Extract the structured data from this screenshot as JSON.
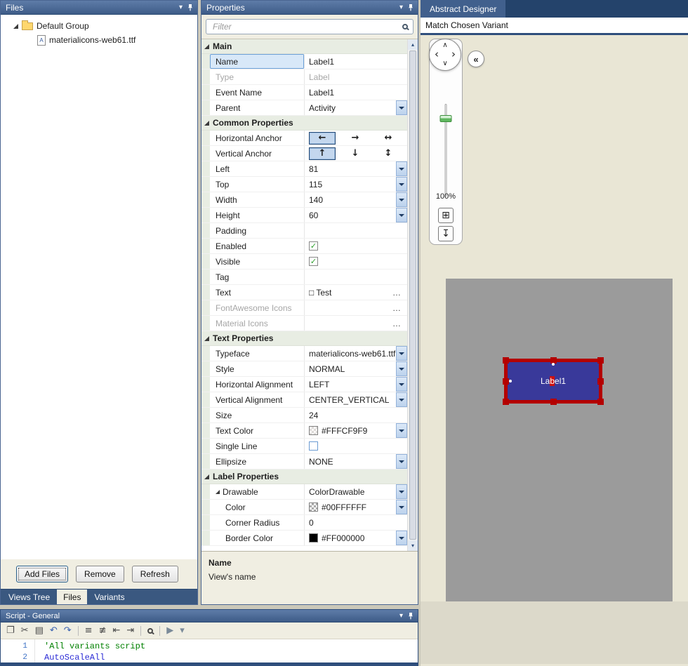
{
  "ui": {
    "menu_glyph": "▾",
    "check_glyph": "✓",
    "ellipsis_glyph": "…",
    "scroll_up_glyph": "▴",
    "scroll_down_glyph": "▾"
  },
  "files": {
    "title": "Files",
    "group_label": "Default Group",
    "file_label": "materialicons-web61.ttf",
    "file_icon_letter": "A",
    "buttons": {
      "add": "Add Files",
      "remove": "Remove",
      "refresh": "Refresh"
    },
    "tabs": {
      "views_tree": "Views Tree",
      "files": "Files",
      "variants": "Variants"
    }
  },
  "properties": {
    "title": "Properties",
    "filter_placeholder": "Filter",
    "description_title": "Name",
    "description_text": "View's name",
    "sections": [
      {
        "title": "Main",
        "rows": [
          {
            "label": "Name",
            "value": "Label1",
            "kind": "text",
            "selected": true
          },
          {
            "label": "Type",
            "value": "Label",
            "kind": "text",
            "muted": true
          },
          {
            "label": "Event Name",
            "value": "Label1",
            "kind": "text"
          },
          {
            "label": "Parent",
            "value": "Activity",
            "kind": "dropdown"
          }
        ]
      },
      {
        "title": "Common Properties",
        "rows": [
          {
            "label": "Horizontal Anchor",
            "kind": "anchors",
            "options": [
              "←",
              "→",
              "↔"
            ],
            "selected_index": 0
          },
          {
            "label": "Vertical Anchor",
            "kind": "anchors",
            "options": [
              "↑",
              "↓",
              "↕"
            ],
            "selected_index": 0
          },
          {
            "label": "Left",
            "value": "81",
            "kind": "dropdown"
          },
          {
            "label": "Top",
            "value": "115",
            "kind": "dropdown"
          },
          {
            "label": "Width",
            "value": "140",
            "kind": "dropdown"
          },
          {
            "label": "Height",
            "value": "60",
            "kind": "dropdown"
          },
          {
            "label": "Padding",
            "kind": "empty"
          },
          {
            "label": "Enabled",
            "kind": "checkbox",
            "checked": true
          },
          {
            "label": "Visible",
            "kind": "checkbox",
            "checked": true
          },
          {
            "label": "Tag",
            "kind": "empty"
          },
          {
            "label": "Text",
            "value": "□ Test",
            "kind": "ellipsis"
          },
          {
            "label": "FontAwesome Icons",
            "kind": "ellipsis",
            "muted": true
          },
          {
            "label": "Material Icons",
            "kind": "ellipsis",
            "muted": true
          }
        ]
      },
      {
        "title": "Text Properties",
        "rows": [
          {
            "label": "Typeface",
            "value": "materialicons-web61.ttf",
            "kind": "dropdown"
          },
          {
            "label": "Style",
            "value": "NORMAL",
            "kind": "dropdown"
          },
          {
            "label": "Horizontal Alignment",
            "value": "LEFT",
            "kind": "dropdown"
          },
          {
            "label": "Vertical Alignment",
            "value": "CENTER_VERTICAL",
            "kind": "dropdown"
          },
          {
            "label": "Size",
            "value": "24",
            "kind": "text"
          },
          {
            "label": "Text Color",
            "value": "#FFFCF9F9",
            "kind": "color",
            "swatch": "light"
          },
          {
            "label": "Single Line",
            "kind": "checkbox",
            "checked": false
          },
          {
            "label": "Ellipsize",
            "value": "NONE",
            "kind": "dropdown"
          }
        ]
      },
      {
        "title": "Label Properties",
        "rows": [
          {
            "label": "Drawable",
            "value": "ColorDrawable",
            "kind": "dropdown",
            "expander": true
          },
          {
            "label": "Color",
            "value": "#00FFFFFF",
            "kind": "color",
            "swatch": "checker",
            "indent": 1
          },
          {
            "label": "Corner Radius",
            "value": "0",
            "kind": "text",
            "indent": 1
          },
          {
            "label": "Border Color",
            "value": "#FF000000",
            "kind": "color",
            "swatch": "black",
            "indent": 1
          }
        ]
      }
    ]
  },
  "designer": {
    "tab_label": "Abstract Designer",
    "variant_label": "Match Chosen Variant",
    "zoom_label": "100%",
    "nav": {
      "up": "∧",
      "down": "∨",
      "left": "‹",
      "right": "›",
      "collapse": "«",
      "fit_glyph": "⊞",
      "capture_glyph": "↧"
    },
    "label_control": {
      "text_prefix": "La",
      "caret_char": "b",
      "text_suffix": "el1"
    }
  },
  "script": {
    "title": "Script - General",
    "toolbar": [
      {
        "name": "copy-icon",
        "glyph": "❐"
      },
      {
        "name": "cut-icon",
        "glyph": "✂"
      },
      {
        "name": "paste-icon",
        "glyph": "▤"
      },
      {
        "name": "undo-icon",
        "glyph": "↶",
        "color": "blue"
      },
      {
        "name": "redo-icon",
        "glyph": "↷",
        "color": "blue"
      },
      {
        "sep": true
      },
      {
        "name": "comment-icon",
        "glyph": "≡"
      },
      {
        "name": "uncomment-icon",
        "glyph": "≢"
      },
      {
        "name": "outdent-icon",
        "glyph": "⇤"
      },
      {
        "name": "indent-icon",
        "glyph": "⇥"
      },
      {
        "sep": true
      },
      {
        "name": "search-icon",
        "shape": "magnifier"
      },
      {
        "sep": true
      },
      {
        "name": "run-icon",
        "glyph": "▶",
        "color": "gray"
      },
      {
        "name": "run-menu-icon",
        "glyph": "▾",
        "color": "gray"
      }
    ],
    "lines": [
      {
        "number": "1",
        "code": "'All variants script",
        "kind": "comment"
      },
      {
        "number": "2",
        "code": "AutoScaleAll",
        "kind": "ident"
      }
    ]
  },
  "colors": {
    "header_blue": "#3E5C88",
    "accent_blue": "#2F4E7C",
    "selection_red": "#B40000",
    "label_fill": "#39399A",
    "canvas_gray": "#9B9B9B",
    "comment_green": "#008000",
    "code_blue": "#2B2BD5",
    "text_color_value": "#FFFCF9F9",
    "drawable_color_value": "#00FFFFFF",
    "border_color_value": "#FF000000"
  }
}
